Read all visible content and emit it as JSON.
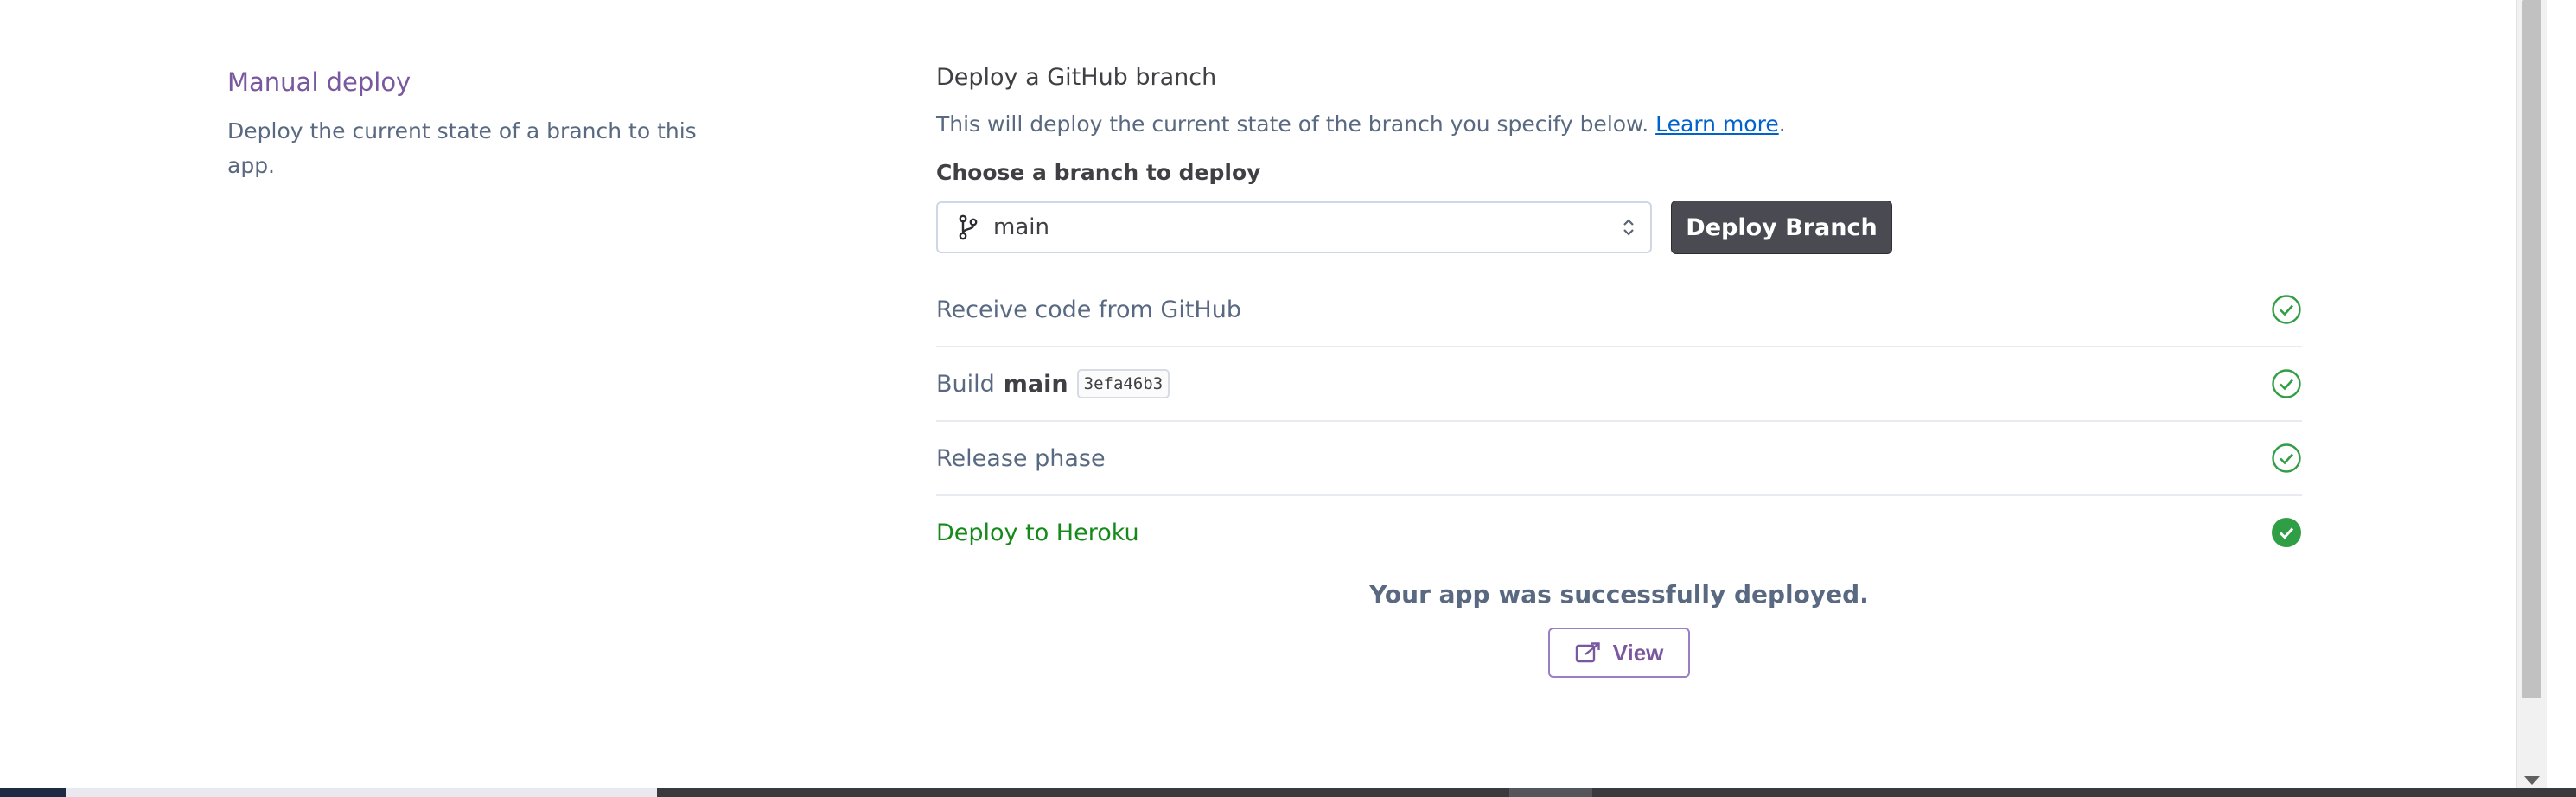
{
  "manual_deploy": {
    "title": "Manual deploy",
    "description": "Deploy the current state of a branch to this app."
  },
  "github_branch": {
    "title": "Deploy a GitHub branch",
    "description": "This will deploy the current state of the branch you specify below.",
    "learn_more": "Learn more",
    "period": ".",
    "choose_label": "Choose a branch to deploy",
    "selected_branch": "main",
    "deploy_button": "Deploy Branch"
  },
  "steps": [
    {
      "label": "Receive code from GitHub",
      "status": "success"
    },
    {
      "label": "Build",
      "branch": "main",
      "commit": "3efa46b3",
      "status": "success"
    },
    {
      "label": "Release phase",
      "status": "success"
    },
    {
      "label": "Deploy to Heroku",
      "status": "success"
    }
  ],
  "result": {
    "message": "Your app was successfully deployed.",
    "view_button": "View"
  },
  "colors": {
    "accent_purple": "#79589f",
    "success_green": "#158a1a",
    "link_blue": "#0062cc",
    "button_dark": "#4a4a52"
  },
  "icons": {
    "branch": "git-branch-icon",
    "select": "select-arrows-icon",
    "check_outline": "check-circle-outline-icon",
    "check_filled": "check-circle-filled-icon",
    "view": "external-link-icon"
  }
}
